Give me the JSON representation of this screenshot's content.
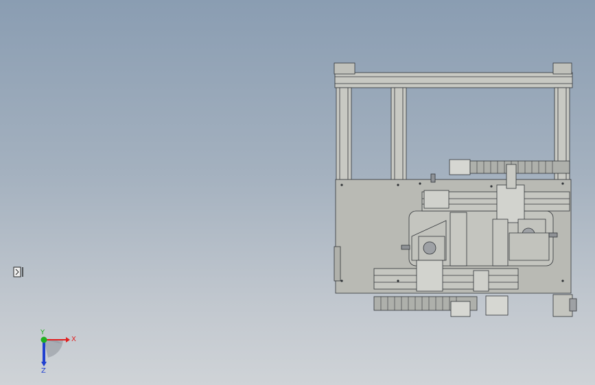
{
  "viewport": {
    "background_top": "#8a9db2",
    "background_bottom": "#cfd3d7"
  },
  "model": {
    "line_color": "#2f3236",
    "plate_color": "#b9bab4",
    "part_color": "#cfd0cb",
    "dark_color": "#6e7176"
  },
  "triad": {
    "x_label": "X",
    "y_label": "Y",
    "z_label": "Z",
    "x_color": "#e02020",
    "y_color": "#20b020",
    "z_color": "#2040d0"
  },
  "icons": {
    "side_icon": "section-view-icon"
  }
}
